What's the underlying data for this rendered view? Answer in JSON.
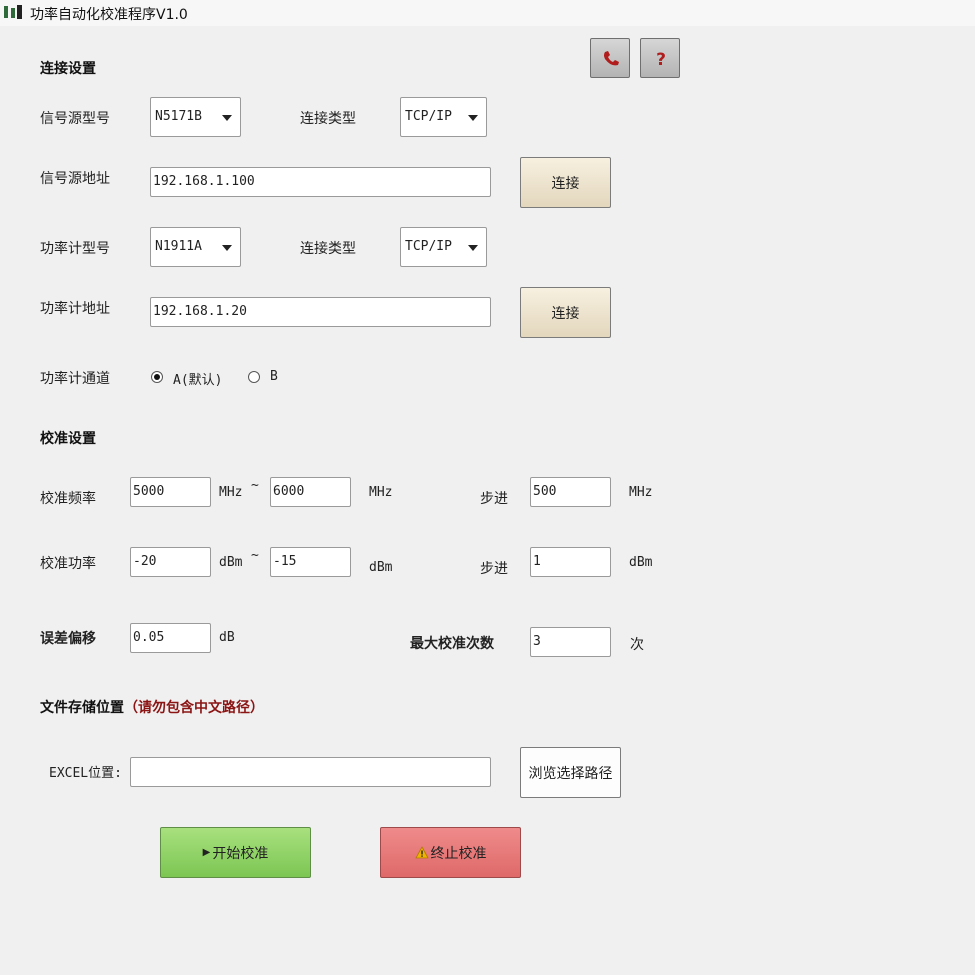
{
  "window": {
    "title": "功率自动化校准程序V1.0",
    "app_icon": "signal-tower-icon"
  },
  "toolbar_icons": {
    "phone": "phone-icon",
    "help": "question-icon"
  },
  "connection": {
    "section_title": "连接设置",
    "signal_source_model_label": "信号源型号",
    "signal_source_model": "N5171B",
    "connection_type_label": "连接类型",
    "signal_connection_type": "TCP/IP",
    "signal_source_address_label": "信号源地址",
    "signal_source_address": "192.168.1.100",
    "connect_label": "连接",
    "power_meter_model_label": "功率计型号",
    "power_meter_model": "N1911A",
    "power_connection_type": "TCP/IP",
    "power_meter_address_label": "功率计地址",
    "power_meter_address": "192.168.1.20",
    "channel_label": "功率计通道",
    "channel_a": "A(默认)",
    "channel_b": "B"
  },
  "calibration": {
    "section_title": "校准设置",
    "freq_label": "校准频率",
    "freq_start": "5000",
    "freq_stop": "6000",
    "freq_unit": "MHz",
    "tilde": "~",
    "step_label": "步进",
    "freq_step": "500",
    "power_label": "校准功率",
    "power_start": "-20",
    "power_stop": "-15",
    "power_unit": "dBm",
    "power_step": "1",
    "offset_label": "误差偏移",
    "offset": "0.05",
    "offset_unit": "dB",
    "max_count_label": "最大校准次数",
    "max_count": "3",
    "count_unit": "次"
  },
  "storage": {
    "section_title": "文件存储位置",
    "warning": "（请勿包含中文路径）",
    "excel_label": "EXCEL位置:",
    "excel_path": "",
    "browse_label": "浏览选择路径"
  },
  "actions": {
    "start_label": "开始校准",
    "stop_label": "终止校准"
  },
  "colors": {
    "warning_text": "#8b1414",
    "start_button": "#8fd466",
    "stop_button": "#e77a7a"
  }
}
